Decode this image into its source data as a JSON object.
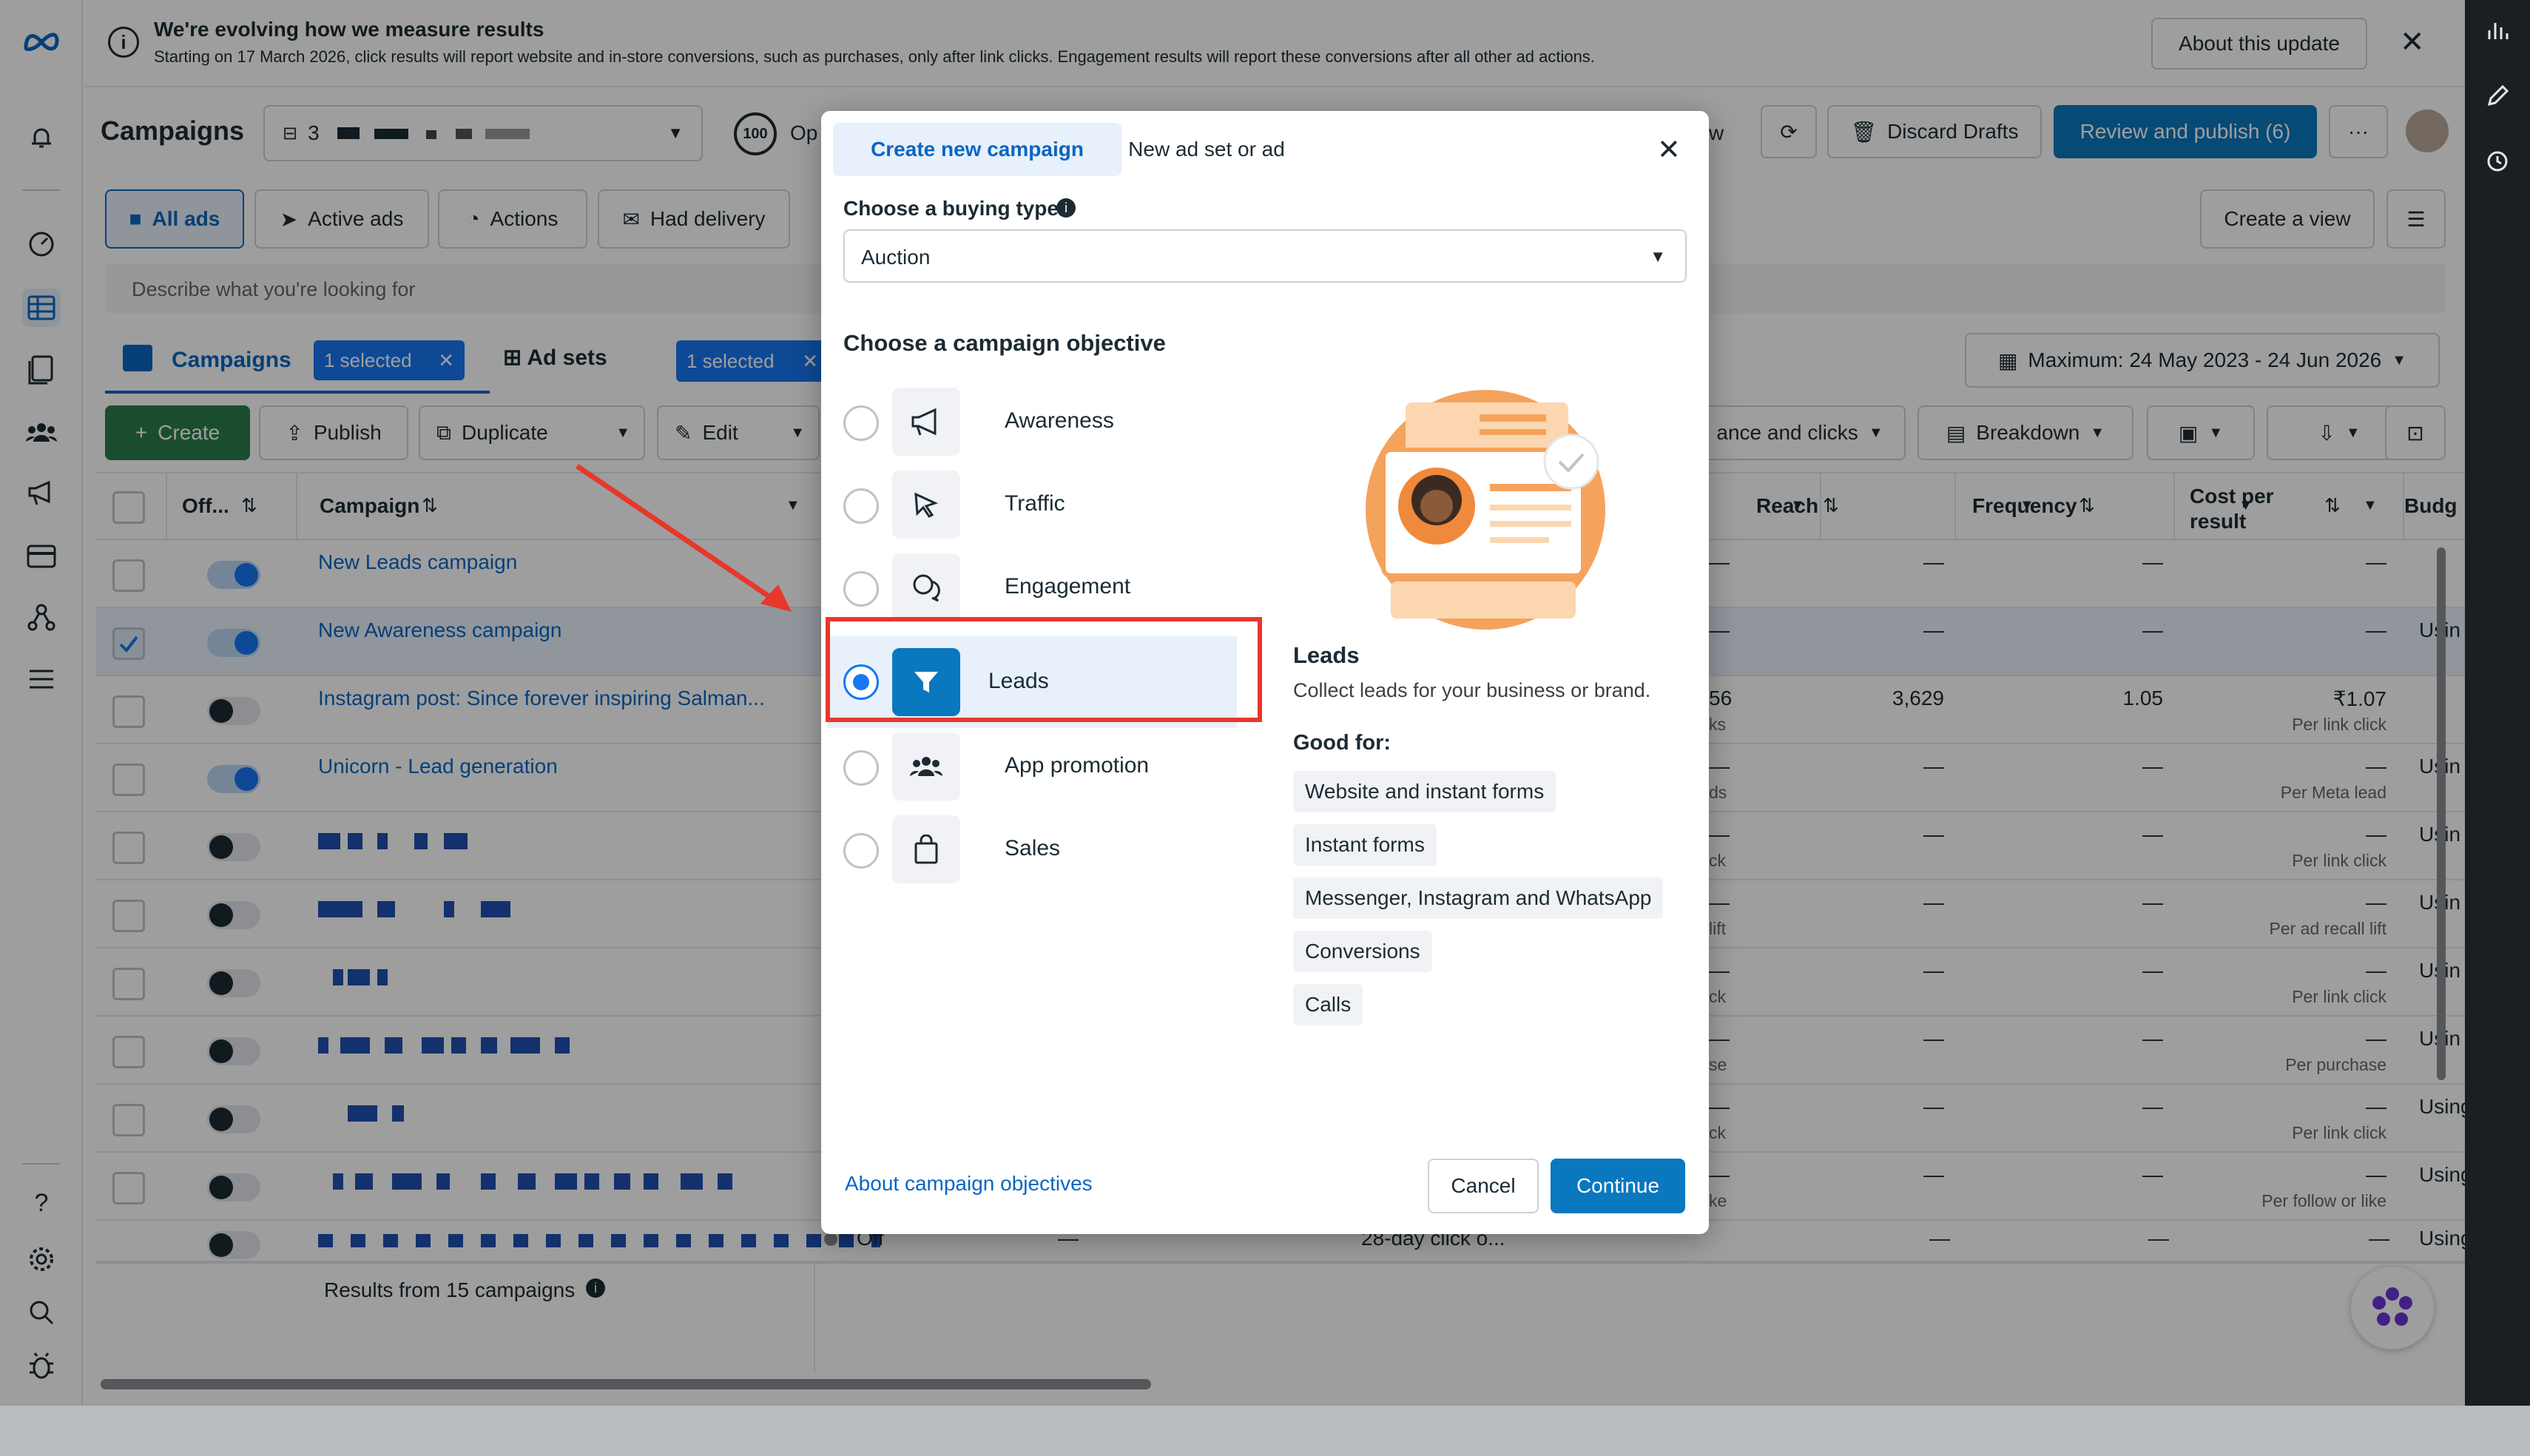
{
  "banner": {
    "title": "We're evolving how we measure results",
    "text": "Starting on 17 March 2026, click results will report website and in-store conversions, such as purchases, only after link clicks. Engagement results will report these conversions after all other ad actions.",
    "about_button": "About this update"
  },
  "header": {
    "title": "Campaigns",
    "account_number": "3",
    "score": "100",
    "score_label": "Op",
    "partial_text": "w",
    "discard_label": "Discard Drafts",
    "publish_label": "Review and publish (6)",
    "more_label": "···"
  },
  "filters": {
    "all_ads": "All ads",
    "active_ads": "Active ads",
    "actions": "Actions",
    "had_delivery": "Had delivery",
    "create_view": "Create a view",
    "search_placeholder": "Describe what you're looking for"
  },
  "tabs": {
    "campaigns": "Campaigns",
    "campaigns_selected": "1 selected",
    "adsets": "Ad sets",
    "adsets_selected": "1 selected",
    "date_range": "Maximum: 24 May 2023 - 24 Jun 2026"
  },
  "toolbar": {
    "create": "Create",
    "publish": "Publish",
    "duplicate": "Duplicate",
    "edit": "Edit",
    "columns": "ance and clicks",
    "breakdown": "Breakdown"
  },
  "table": {
    "headers": {
      "off": "Off...",
      "campaign": "Campaign",
      "reach": "Reach",
      "frequency": "Frequency",
      "cost": "Cost per result",
      "budget": "Budg"
    },
    "rows": [
      {
        "name": "New Leads campaign",
        "reach": "—",
        "frequency": "—",
        "cost": "—",
        "cost_sub": "",
        "budget": "",
        "left_sub": "",
        "left_val": "—"
      },
      {
        "name": "New Awareness campaign",
        "reach": "—",
        "frequency": "—",
        "cost": "—",
        "cost_sub": "",
        "budget": "Usin",
        "left_sub": "",
        "left_val": "—"
      },
      {
        "name": "Instagram post: Since forever inspiring Salman...",
        "reach": "3,629",
        "frequency": "1.05",
        "cost": "₹1.07",
        "cost_sub": "Per link click",
        "budget": "",
        "left_sub": "ks",
        "left_val": "56"
      },
      {
        "name": "Unicorn - Lead generation",
        "reach": "—",
        "frequency": "—",
        "cost": "—",
        "cost_sub": "Per Meta lead",
        "budget": "Usin",
        "left_sub": "ds",
        "left_val": "—"
      },
      {
        "name": "",
        "reach": "—",
        "frequency": "—",
        "cost": "—",
        "cost_sub": "Per link click",
        "budget": "Usin",
        "left_sub": "ck",
        "left_val": "—"
      },
      {
        "name": "",
        "reach": "—",
        "frequency": "—",
        "cost": "—",
        "cost_sub": "Per ad recall lift",
        "budget": "Usin",
        "left_sub": "lift",
        "left_val": "—"
      },
      {
        "name": "",
        "reach": "—",
        "frequency": "—",
        "cost": "—",
        "cost_sub": "Per link click",
        "budget": "Usin",
        "left_sub": "ck",
        "left_val": "—"
      },
      {
        "name": "",
        "reach": "—",
        "frequency": "—",
        "cost": "—",
        "cost_sub": "Per purchase",
        "budget": "Usin",
        "left_sub": "se",
        "left_val": "—"
      },
      {
        "name": "",
        "reach": "—",
        "frequency": "—",
        "cost": "—",
        "cost_sub": "Per link click",
        "budget": "Using",
        "left_sub": "ck",
        "left_val": "—"
      },
      {
        "name": "",
        "reach": "—",
        "frequency": "—",
        "cost": "—",
        "cost_sub": "Per follow or like",
        "budget": "Using",
        "left_sub": "ke",
        "left_val": "—"
      }
    ],
    "last_row": {
      "status": "Off",
      "dash": "—",
      "attribution": "28-day click o...",
      "reach": "—",
      "frequency": "—",
      "cost": "—",
      "budget": "Using"
    },
    "footer": "Results from 15 campaigns"
  },
  "modal": {
    "tab_create": "Create new campaign",
    "tab_new": "New ad set or ad",
    "buying_type_label": "Choose a buying type",
    "buying_type_value": "Auction",
    "objective_heading": "Choose a campaign objective",
    "objectives": [
      {
        "label": "Awareness",
        "icon": "megaphone-icon",
        "selected": false
      },
      {
        "label": "Traffic",
        "icon": "cursor-icon",
        "selected": false
      },
      {
        "label": "Engagement",
        "icon": "chat-bubbles-icon",
        "selected": false
      },
      {
        "label": "Leads",
        "icon": "funnel-icon",
        "selected": true
      },
      {
        "label": "App promotion",
        "icon": "people-icon",
        "selected": false
      },
      {
        "label": "Sales",
        "icon": "shopping-bag-icon",
        "selected": false
      }
    ],
    "detail_title": "Leads",
    "detail_desc": "Collect leads for your business or brand.",
    "good_for_label": "Good for:",
    "good_for": [
      "Website and instant forms",
      "Instant forms",
      "Messenger, Instagram and WhatsApp",
      "Conversions",
      "Calls"
    ],
    "about_link": "About campaign objectives",
    "cancel": "Cancel",
    "continue": "Continue"
  },
  "colors": {
    "accent": "#0a78be",
    "brand_blue": "#1877f2",
    "highlight_red": "#e8372c",
    "illustration_orange": "#f5a35c"
  }
}
